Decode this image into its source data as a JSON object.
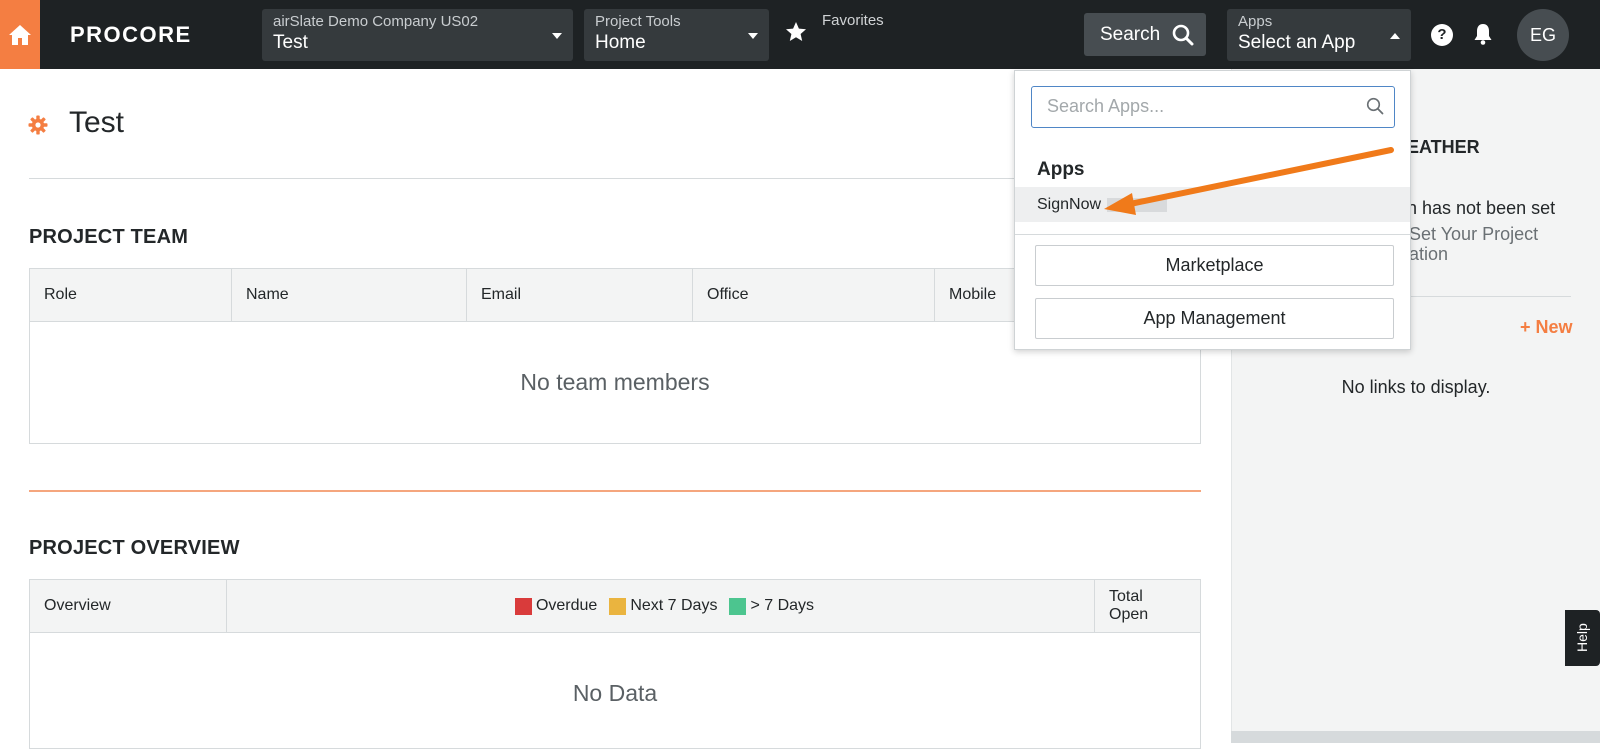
{
  "topbar": {
    "logo": "PROCORE",
    "company_selector": {
      "label": "airSlate Demo Company US02",
      "value": "Test"
    },
    "tools_selector": {
      "label": "Project Tools",
      "value": "Home"
    },
    "favorites_label": "Favorites",
    "search_label": "Search",
    "apps_selector": {
      "label": "Apps",
      "value": "Select an App"
    },
    "help_glyph": "?",
    "user_initials": "EG"
  },
  "page": {
    "title": "Test"
  },
  "project_team": {
    "heading": "PROJECT TEAM",
    "columns": [
      "Role",
      "Name",
      "Email",
      "Office",
      "Mobile"
    ],
    "empty_text": "No team members"
  },
  "project_overview": {
    "heading": "PROJECT OVERVIEW",
    "columns": {
      "overview": "Overview",
      "total": "Total Open"
    },
    "legend": [
      {
        "label": "Overdue",
        "color": "#d93b3b"
      },
      {
        "label": "Next 7 Days",
        "color": "#eab43f"
      },
      {
        "label": "> 7 Days",
        "color": "#4cc58f"
      }
    ],
    "empty_text": "No Data"
  },
  "right_panel": {
    "weather_title": "EATHER",
    "location_text": "n has not been set",
    "location_link": "Set Your Project ation",
    "new_link": "+ New",
    "no_links_text": "No links to display.",
    "help_tab": "Help"
  },
  "apps_dropdown": {
    "search_placeholder": "Search Apps...",
    "heading": "Apps",
    "items": [
      "SignNow"
    ],
    "marketplace_button": "Marketplace",
    "app_management_button": "App Management"
  },
  "colors": {
    "brand_orange": "#f47e42",
    "topbar_bg": "#1e2224",
    "annotation_arrow": "#f07a1a"
  },
  "icons": {
    "home": "home-icon",
    "favorite": "star-icon",
    "search": "search-icon",
    "help": "help-icon",
    "notifications": "bell-icon",
    "settings": "gear-icon"
  }
}
